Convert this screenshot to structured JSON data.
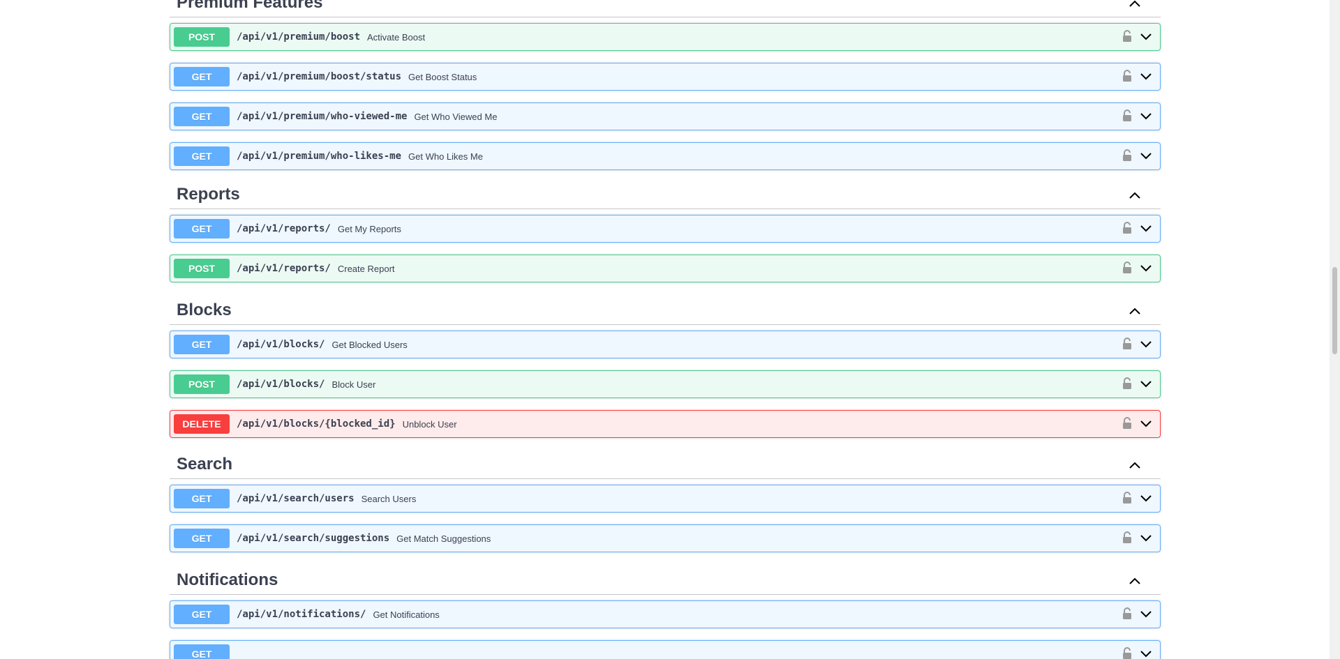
{
  "sections": [
    {
      "title": "Premium Features",
      "operations": [
        {
          "method": "POST",
          "path": "/api/v1/premium/boost",
          "summary": "Activate Boost"
        },
        {
          "method": "GET",
          "path": "/api/v1/premium/boost/status",
          "summary": "Get Boost Status"
        },
        {
          "method": "GET",
          "path": "/api/v1/premium/who-viewed-me",
          "summary": "Get Who Viewed Me"
        },
        {
          "method": "GET",
          "path": "/api/v1/premium/who-likes-me",
          "summary": "Get Who Likes Me"
        }
      ]
    },
    {
      "title": "Reports",
      "operations": [
        {
          "method": "GET",
          "path": "/api/v1/reports/",
          "summary": "Get My Reports"
        },
        {
          "method": "POST",
          "path": "/api/v1/reports/",
          "summary": "Create Report"
        }
      ]
    },
    {
      "title": "Blocks",
      "operations": [
        {
          "method": "GET",
          "path": "/api/v1/blocks/",
          "summary": "Get Blocked Users"
        },
        {
          "method": "POST",
          "path": "/api/v1/blocks/",
          "summary": "Block User"
        },
        {
          "method": "DELETE",
          "path": "/api/v1/blocks/{blocked_id}",
          "summary": "Unblock User"
        }
      ]
    },
    {
      "title": "Search",
      "operations": [
        {
          "method": "GET",
          "path": "/api/v1/search/users",
          "summary": "Search Users"
        },
        {
          "method": "GET",
          "path": "/api/v1/search/suggestions",
          "summary": "Get Match Suggestions"
        }
      ]
    },
    {
      "title": "Notifications",
      "operations": [
        {
          "method": "GET",
          "path": "/api/v1/notifications/",
          "summary": "Get Notifications"
        },
        {
          "method": "GET",
          "path": "",
          "summary": ""
        }
      ]
    }
  ],
  "icons": {
    "section_toggle": "chevron-up-icon",
    "lock": "lock-icon",
    "expand": "chevron-down-icon"
  },
  "colors": {
    "get": "#61affe",
    "post": "#49cc90",
    "delete": "#f93e3e",
    "text": "#3b4151"
  }
}
